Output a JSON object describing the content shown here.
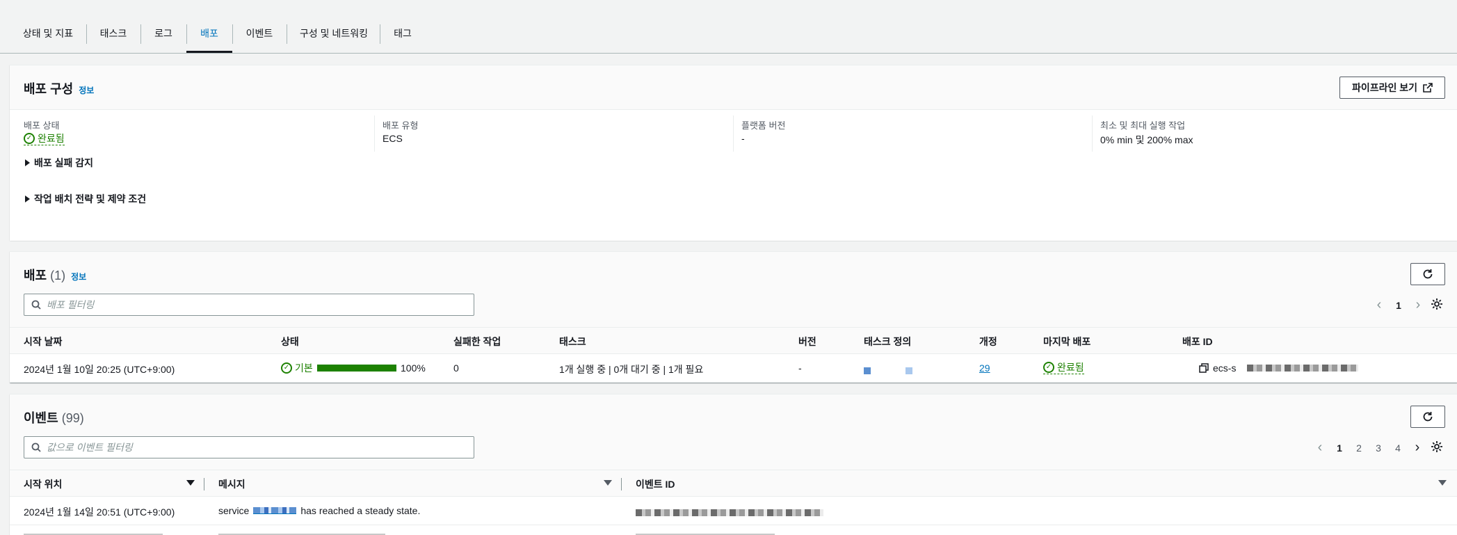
{
  "tabs": [
    {
      "label": "상태 및 지표"
    },
    {
      "label": "태스크"
    },
    {
      "label": "로그"
    },
    {
      "label": "배포",
      "active": true
    },
    {
      "label": "이벤트"
    },
    {
      "label": "구성 및 네트워킹"
    },
    {
      "label": "태그"
    }
  ],
  "deploy_config": {
    "title": "배포 구성",
    "info": "정보",
    "pipeline_button": "파이프라인 보기",
    "fields": [
      {
        "label": "배포 상태",
        "value": "완료됨",
        "status": "success"
      },
      {
        "label": "배포 유형",
        "value": "ECS"
      },
      {
        "label": "플랫폼 버전",
        "value": "-"
      },
      {
        "label": "최소 및 최대 실행 작업",
        "value": "0% min 및 200% max"
      }
    ],
    "expanders": [
      "배포 실패 감지",
      "작업 배치 전략 및 제약 조건"
    ]
  },
  "deployments": {
    "title": "배포",
    "count": "(1)",
    "info": "정보",
    "filter_placeholder": "배포 필터링",
    "pager": {
      "current": "1"
    },
    "columns": [
      "시작 날짜",
      "상태",
      "실패한 작업",
      "태스크",
      "버전",
      "태스크 정의",
      "개정",
      "마지막 배포",
      "배포 ID"
    ],
    "rows": [
      {
        "start": "2024년 1월 10일 20:25 (UTC+9:00)",
        "status": "기본",
        "progress_pct": 100,
        "progress_label": "100%",
        "failed": "0",
        "tasks": "1개 실행 중 | 0개 대기 중 | 1개 필요",
        "version": "-",
        "revision": "29",
        "last_deploy": "완료됨",
        "deploy_id_prefix": "ecs-s"
      }
    ]
  },
  "events": {
    "title": "이벤트",
    "count": "(99)",
    "filter_placeholder": "값으로 이벤트 필터링",
    "pages": [
      "1",
      "2",
      "3",
      "4"
    ],
    "columns": [
      "시작 위치",
      "메시지",
      "이벤트 ID"
    ],
    "rows": [
      {
        "start": "2024년 1월 14일 20:51 (UTC+9:00)",
        "msg_prefix": "service",
        "msg_suffix": "has reached a steady state."
      }
    ]
  },
  "colors": {
    "accent": "#0073bb",
    "success": "#1d8102",
    "text": "#16191f"
  }
}
